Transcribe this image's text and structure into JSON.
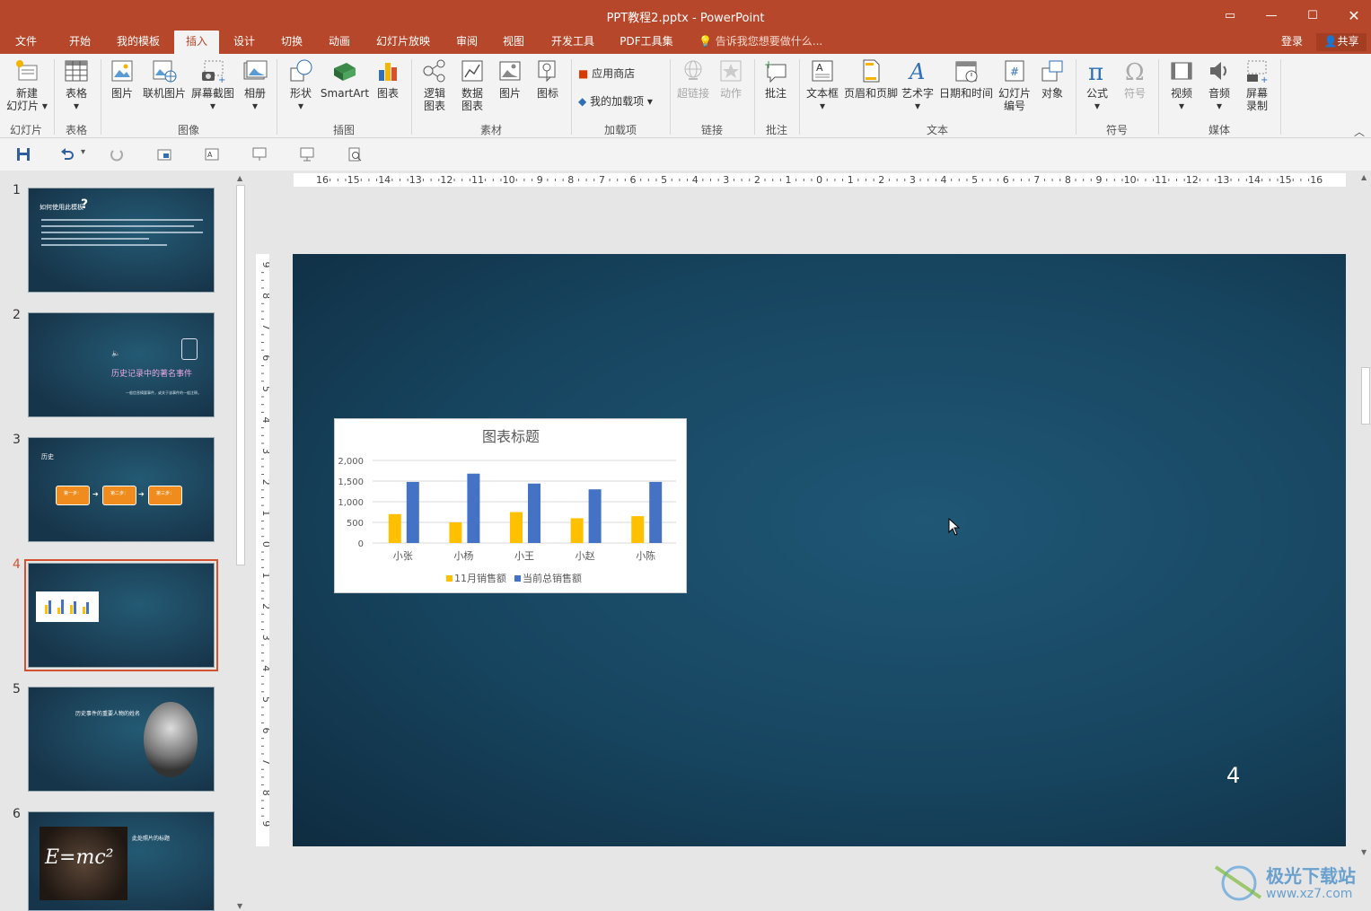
{
  "window": {
    "title": "PPT教程2.pptx - PowerPoint"
  },
  "tabs": [
    "文件",
    "开始",
    "我的模板",
    "插入",
    "设计",
    "切换",
    "动画",
    "幻灯片放映",
    "审阅",
    "视图",
    "开发工具",
    "PDF工具集"
  ],
  "active_tab": "插入",
  "tell_me": "告诉我您想要做什么...",
  "login": "登录",
  "share": "共享",
  "ribbon": {
    "buttons": {
      "new_slide": "新建\n幻灯片",
      "table": "表格",
      "picture": "图片",
      "online_picture": "联机图片",
      "screenshot": "屏幕截图",
      "album": "相册",
      "shapes": "形状",
      "smartart": "SmartArt",
      "chart": "图表",
      "logic_chart": "逻辑\n图表",
      "data_chart": "数据\n图表",
      "material_picture": "图片",
      "icon": "图标",
      "store": "应用商店",
      "my_addins": "我的加载项",
      "hyperlink": "超链接",
      "action": "动作",
      "comment": "批注",
      "textbox": "文本框",
      "header_footer": "页眉和页脚",
      "wordart": "艺术字",
      "date_time": "日期和时间",
      "slide_number": "幻灯片\n编号",
      "object": "对象",
      "equation": "公式",
      "symbol": "符号",
      "video": "视频",
      "audio": "音频",
      "screen_record": "屏幕\n录制"
    },
    "groups": {
      "slides": "幻灯片",
      "tables": "表格",
      "images": "图像",
      "illustrations": "插图",
      "materials": "素材",
      "addins": "加载项",
      "links": "链接",
      "comments": "批注",
      "text": "文本",
      "symbols": "符号",
      "media": "媒体"
    }
  },
  "thumbnails": [
    {
      "num": "1",
      "title": "如何使用此模板",
      "mark": "?"
    },
    {
      "num": "2",
      "title": "历史记录中的著名事件",
      "sub": "一般信息摘要事件，或关于该事件的一般注释。"
    },
    {
      "num": "3",
      "title": "历史",
      "steps": [
        "第一步：",
        "第二步：",
        "第三步："
      ]
    },
    {
      "num": "4",
      "title": ""
    },
    {
      "num": "5",
      "title": "历史事件的重要人物的姓名"
    },
    {
      "num": "6",
      "title": "此处照片的标题",
      "equation": "E=mc²"
    }
  ],
  "selected_slide": "4",
  "slide_page_number": "4",
  "ruler": {
    "h": [
      "16",
      "15",
      "14",
      "13",
      "12",
      "11",
      "10",
      "9",
      "8",
      "7",
      "6",
      "5",
      "4",
      "3",
      "2",
      "1",
      "0",
      "1",
      "2",
      "3",
      "4",
      "5",
      "6",
      "7",
      "8",
      "9",
      "10",
      "11",
      "12",
      "13",
      "14",
      "15",
      "16"
    ],
    "v": [
      "9",
      "8",
      "7",
      "6",
      "5",
      "4",
      "3",
      "2",
      "1",
      "0",
      "1",
      "2",
      "3",
      "4",
      "5",
      "6",
      "7",
      "8",
      "9"
    ]
  },
  "chart_data": {
    "type": "bar",
    "title": "图表标题",
    "categories": [
      "小张",
      "小杨",
      "小王",
      "小赵",
      "小陈"
    ],
    "series": [
      {
        "name": "11月销售额",
        "color": "#ffc000",
        "values": [
          700,
          500,
          750,
          600,
          650
        ]
      },
      {
        "name": "当前总销售额",
        "color": "#4472c4",
        "values": [
          1480,
          1680,
          1440,
          1300,
          1480
        ]
      }
    ],
    "ylim": [
      0,
      2000
    ],
    "yticks": [
      "0",
      "500",
      "1,000",
      "1,500",
      "2,000"
    ],
    "ytick_values": [
      0,
      500,
      1000,
      1500,
      2000
    ],
    "grid": true,
    "legend": "bottom"
  },
  "watermark": {
    "line1": "极光下载站",
    "line2": "www.xz7.com"
  },
  "colors": {
    "accent": "#b7472a",
    "selected": "#d35230"
  }
}
